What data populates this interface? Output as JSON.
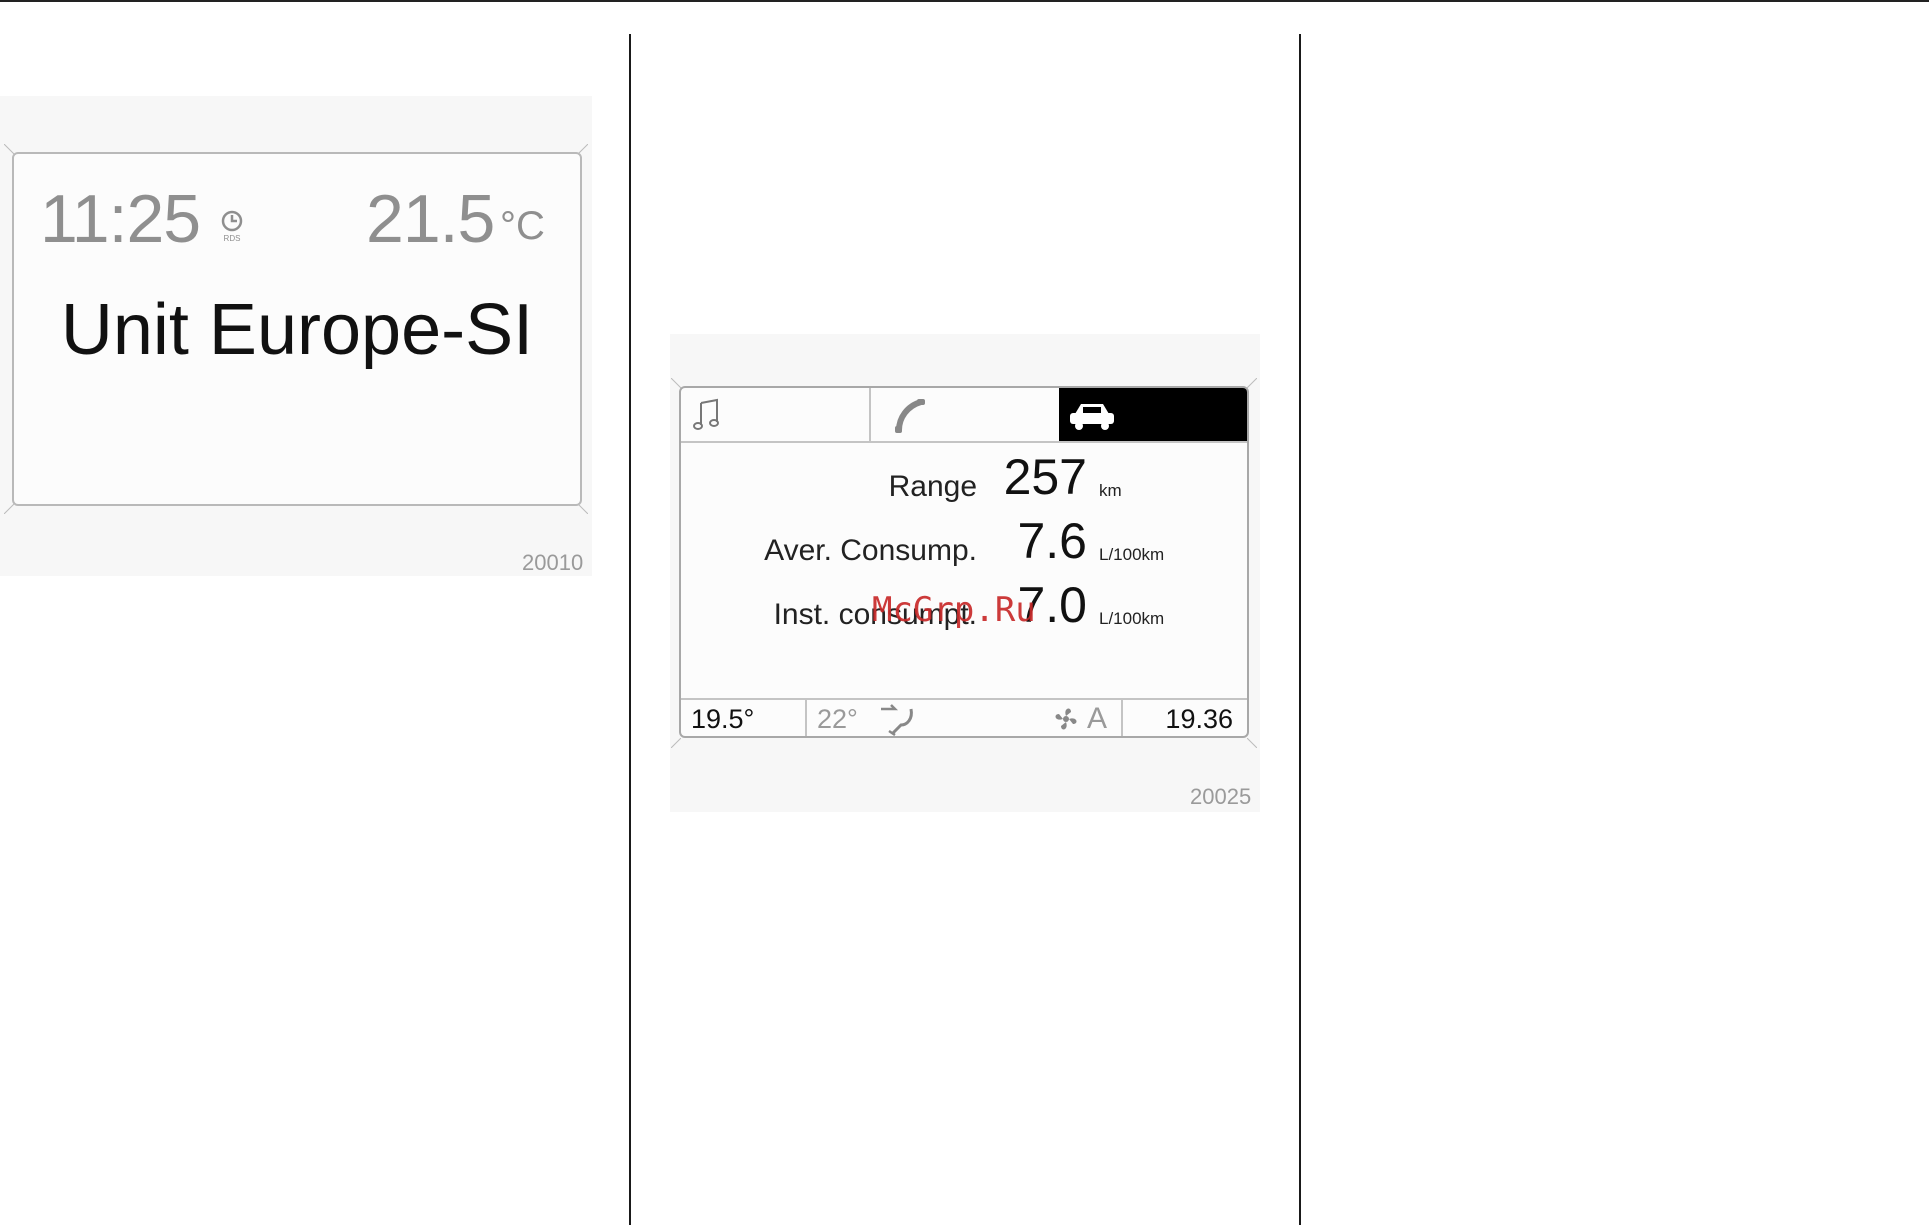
{
  "figure1": {
    "time": "11:25",
    "clock_icon_caption": "RDS",
    "temperature": "21.5",
    "temperature_unit": "°C",
    "setting_text": "Unit Europe-SI",
    "figure_code": "20010"
  },
  "figure2": {
    "tabs": [
      {
        "icon": "music-note-icon",
        "active": false
      },
      {
        "icon": "phone-icon",
        "active": false
      },
      {
        "icon": "car-icon",
        "active": true
      }
    ],
    "rows": [
      {
        "label": "Range",
        "value": "257",
        "unit": "km"
      },
      {
        "label": "Aver. Consump.",
        "value": "7.6",
        "unit": "L/100km"
      },
      {
        "label": "Inst. consumpt.",
        "value": "7.0",
        "unit": "L/100km"
      }
    ],
    "status_bar": {
      "left_temp": "19.5°",
      "set_temp": "22°",
      "auto_label": "A",
      "clock": "19.36"
    },
    "figure_code": "20025"
  },
  "watermark": "McGrp.Ru",
  "colors": {
    "watermark": "#c92a2a",
    "active_tab": "#000000"
  }
}
